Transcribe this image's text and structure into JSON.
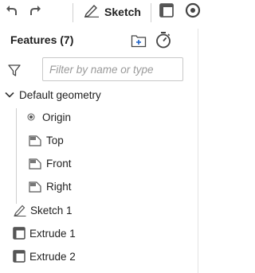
{
  "toolbar": {
    "undo_icon": "undo-icon",
    "redo_icon": "redo-icon",
    "sketch_label": "Sketch",
    "extrude_icon": "extrude-icon"
  },
  "features": {
    "title": "Features (7)",
    "add_folder_icon": "add-folder-icon",
    "rollback_icon": "stopwatch-icon"
  },
  "filter": {
    "placeholder": "Filter by name or type",
    "value": ""
  },
  "tree": {
    "default_geometry": "Default geometry",
    "origin": "Origin",
    "top": "Top",
    "front": "Front",
    "right": "Right",
    "sketch1": "Sketch 1",
    "extrude1": "Extrude 1",
    "extrude2": "Extrude 2"
  },
  "colors": {
    "text": "#1f1f1f",
    "icon": "#555555",
    "accent_blue": "#1f64c8"
  }
}
